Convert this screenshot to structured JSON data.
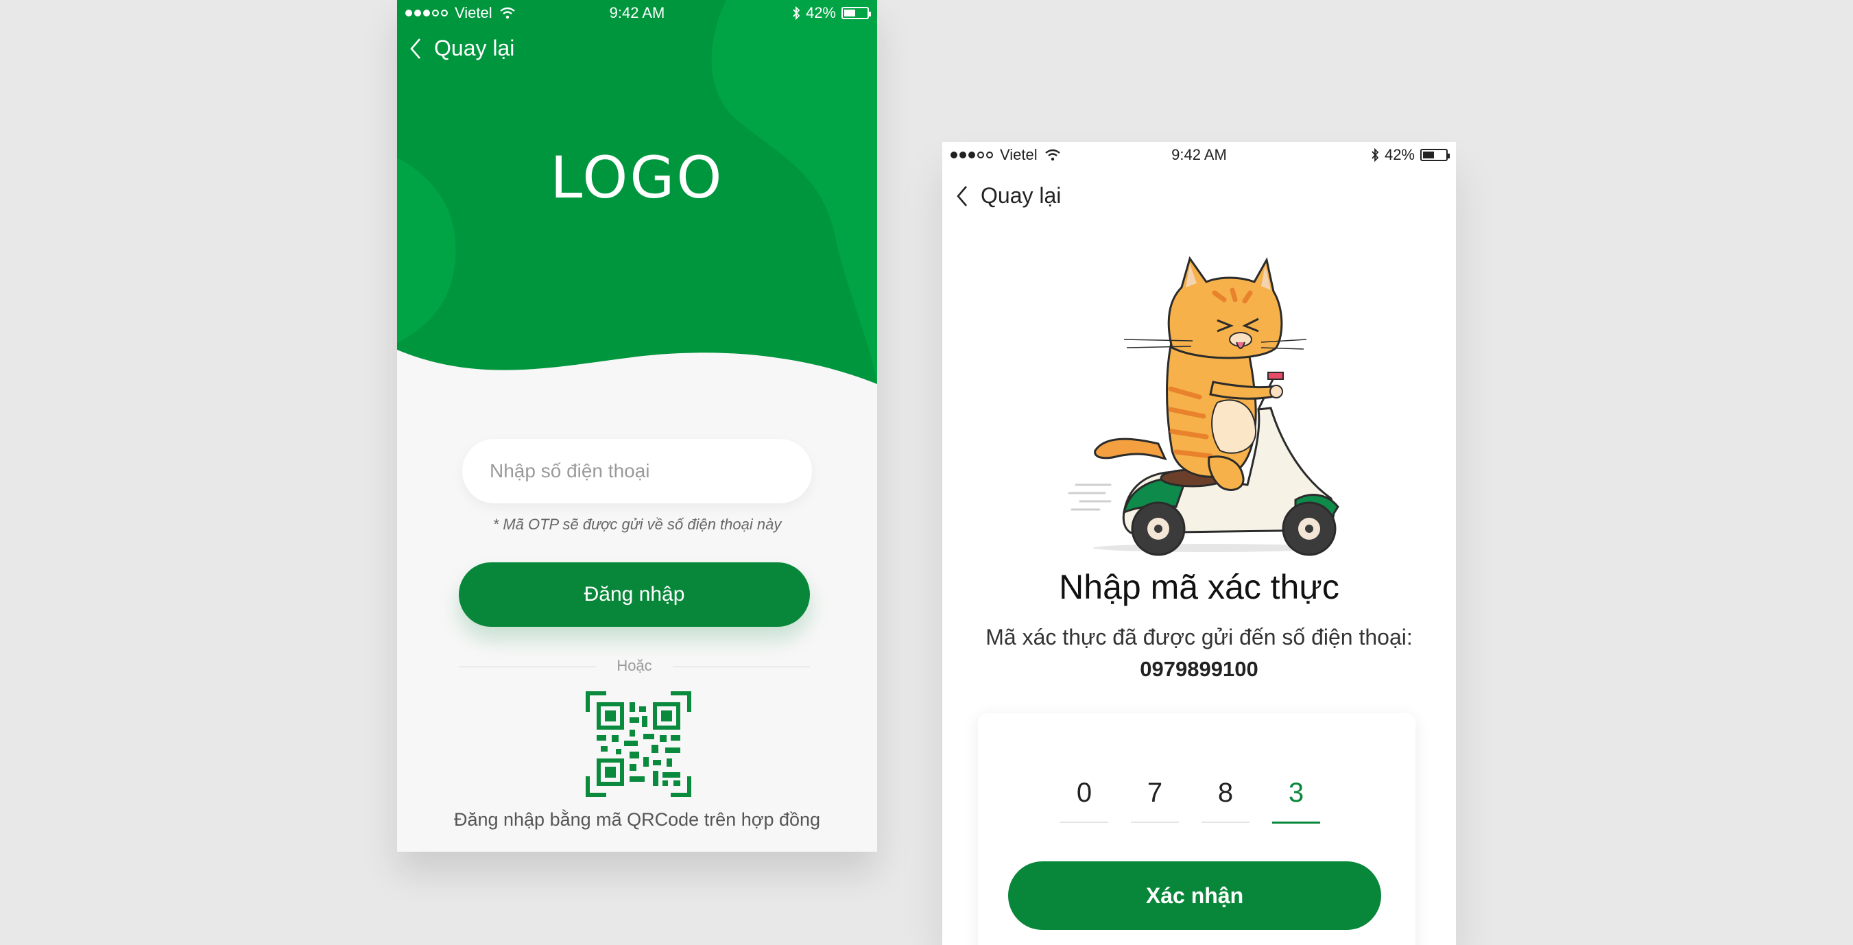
{
  "colors": {
    "brand_green": "#08873a",
    "hero_green": "#00a040",
    "background": "#e8e8e8"
  },
  "login_screen": {
    "status_bar": {
      "carrier": "Vietel",
      "time": "9:42 AM",
      "battery": "42%"
    },
    "back_label": "Quay lại",
    "logo_text": "LOGO",
    "phone_placeholder": "Nhập số điện thoại",
    "otp_note": "* Mã OTP sẽ được gửi về số điện thoại này",
    "login_button": "Đăng nhập",
    "divider_text": "Hoặc",
    "qr_caption": "Đăng nhập bằng mã QRCode trên hợp đồng"
  },
  "verify_screen": {
    "status_bar": {
      "carrier": "Vietel",
      "time": "9:42 AM",
      "battery": "42%"
    },
    "back_label": "Quay lại",
    "title": "Nhập mã xác thực",
    "description": "Mã xác thực đã được gửi đến số điện thoại:",
    "phone_number": "0979899100",
    "otp_digits": [
      "0",
      "7",
      "8",
      "3"
    ],
    "confirm_button": "Xác nhận"
  }
}
